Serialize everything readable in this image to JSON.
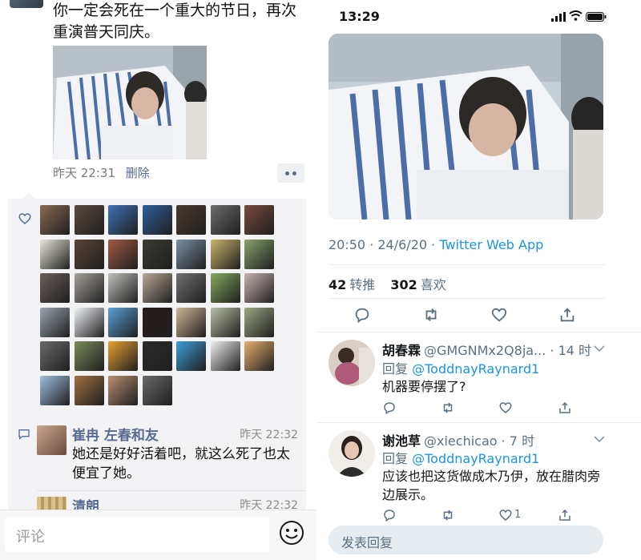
{
  "left_panel": {
    "post": {
      "text": "你一定会死在一个重大的节日，再次重演普天同庆。",
      "time": "昨天 22:31",
      "delete_label": "删除"
    },
    "likes_avatar_colors": [
      "#8a6a52",
      "#5b4a3c",
      "#3f72b8",
      "#2f5e9c",
      "#4b3a2e",
      "#6d6d6d",
      "#7a4b3c",
      "#e9e7d8",
      "#5a4436",
      "#a05a42",
      "#3c3a33",
      "#7d8fa3",
      "#c8b46a",
      "#88a36a",
      "#6c5f5a",
      "#a7a29c",
      "#c2c0bb",
      "#b9a895",
      "#707070",
      "#86a95e",
      "#c8b3b0",
      "#9aa6b0",
      "#f2f4f7",
      "#5aa0d8",
      "#2a1a1a",
      "#cfb696",
      "#b8c0a4",
      "#9ba882",
      "#6a6a6a",
      "#7a8c5a",
      "#e8a030",
      "#2b2b2b",
      "#3b9fd8",
      "#f0f0f0",
      "#e8b070",
      "#9cc0e0",
      "#a07040",
      "#b89070",
      "#6a6a6a"
    ],
    "comments": [
      {
        "name": "崔冉 左春和友",
        "time": "昨天 22:32",
        "text": "她还是好好活着吧，就这么死了也太便宜了她。"
      },
      {
        "name": "清朗",
        "time": "昨天 22:32"
      }
    ],
    "reply_placeholder": "评论"
  },
  "right_panel": {
    "status_time": "13:29",
    "tweet": {
      "timestamp": "20:50 · 24/6/20 · ",
      "source": "Twitter Web App",
      "retweets": "42",
      "retweets_label": "转推",
      "likes": "302",
      "likes_label": "喜欢"
    },
    "replies": [
      {
        "name": "胡春霖",
        "handle_time": "@GMGNMx2Q8ja... · 14 时",
        "reply_prefix": "回复 ",
        "mention": "@ToddnayRaynard1",
        "text": "机器要停摆了?",
        "like_count": ""
      },
      {
        "name": "谢池草",
        "handle_time": "@xiechicao · 7 时",
        "reply_prefix": "回复 ",
        "mention": "@ToddnayRaynard1",
        "text": "应该也把这货做成木乃伊，放在腊肉旁边展示。",
        "like_count": "1"
      }
    ],
    "compose_placeholder": "发表回复"
  }
}
